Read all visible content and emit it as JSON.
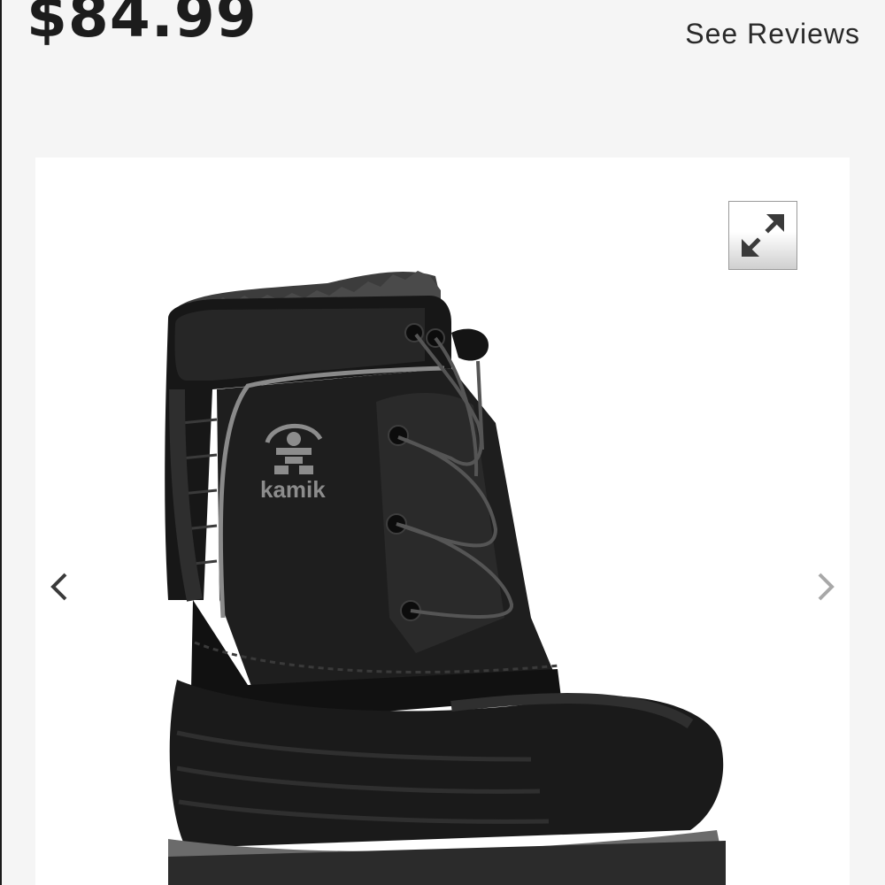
{
  "product": {
    "price": "$84.99",
    "reviews_link": "See Reviews"
  },
  "gallery": {
    "image_alt": "kamik black winter boot",
    "brand_mark": "kamik",
    "expand_icon": "expand-arrows-icon",
    "prev_icon": "chevron-left-icon",
    "next_icon": "chevron-right-icon"
  },
  "colors": {
    "background": "#f5f5f5",
    "gallery_background": "#ffffff",
    "price_text": "#1c1c1c",
    "boot_body": "#1b1b1b",
    "boot_accent": "#8a8a8a"
  }
}
